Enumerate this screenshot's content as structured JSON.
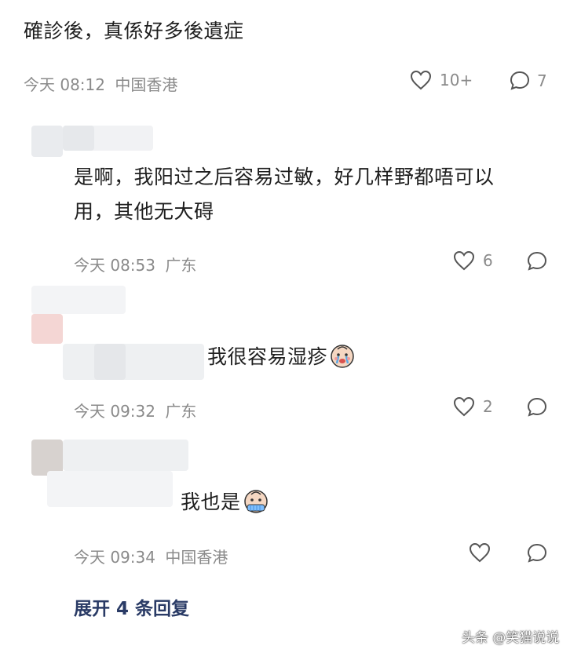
{
  "post": {
    "text": "確診後，真係好多後遺症",
    "time": "今天 08:12",
    "location": "中国香港",
    "like_count": "10+",
    "comment_count": "7"
  },
  "replies": [
    {
      "text_line1": "是啊，我阳过之后容易过敏，好几样野都唔可以",
      "text_line2": "用，其他无大碍",
      "time": "今天 08:53",
      "location": "广东",
      "like_count": "6"
    },
    {
      "text": "我很容易湿疹",
      "emoji": "crying-face-emoji",
      "time": "今天 09:32",
      "location": "广东",
      "like_count": "2"
    },
    {
      "text": "我也是",
      "emoji": "crying-face-emoji",
      "time": "今天 09:34",
      "location": "中国香港",
      "like_count": ""
    }
  ],
  "expand_label": "展开 4 条回复",
  "watermark": "头条 @笑猫说说",
  "colors": {
    "text": "#1f1f1f",
    "meta": "#8a8a8a",
    "expand": "#2a3b66",
    "icon": "#555555"
  }
}
